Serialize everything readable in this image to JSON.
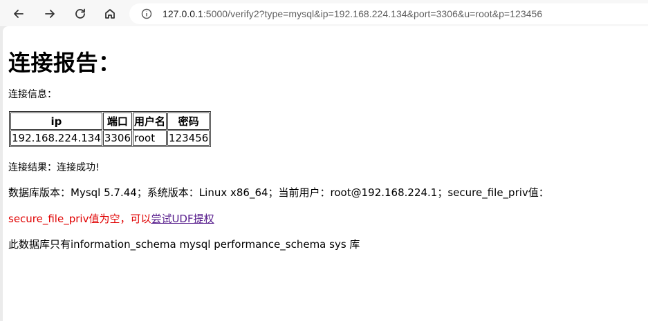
{
  "browser": {
    "url_host": "127.0.0.1",
    "url_rest": ":5000/verify2?type=mysql&ip=192.168.224.134&port=3306&u=root&p=123456"
  },
  "page": {
    "title": "连接报告：",
    "conn_info_label": "连接信息：",
    "table": {
      "headers": [
        "ip",
        "端口",
        "用户名",
        "密码"
      ],
      "rows": [
        [
          "192.168.224.134",
          "3306",
          "root",
          "123456"
        ]
      ]
    },
    "result_line": "连接结果：连接成功!",
    "version_line": "数据库版本：Mysql 5.7.44；系统版本：Linux x86_64；当前用户：root@192.168.224.1；secure_file_priv值：",
    "udf_text": "secure_file_priv值为空，可以",
    "udf_link": "尝试UDF提权",
    "db_line": "此数据库只有information_schema mysql performance_schema sys 库"
  }
}
